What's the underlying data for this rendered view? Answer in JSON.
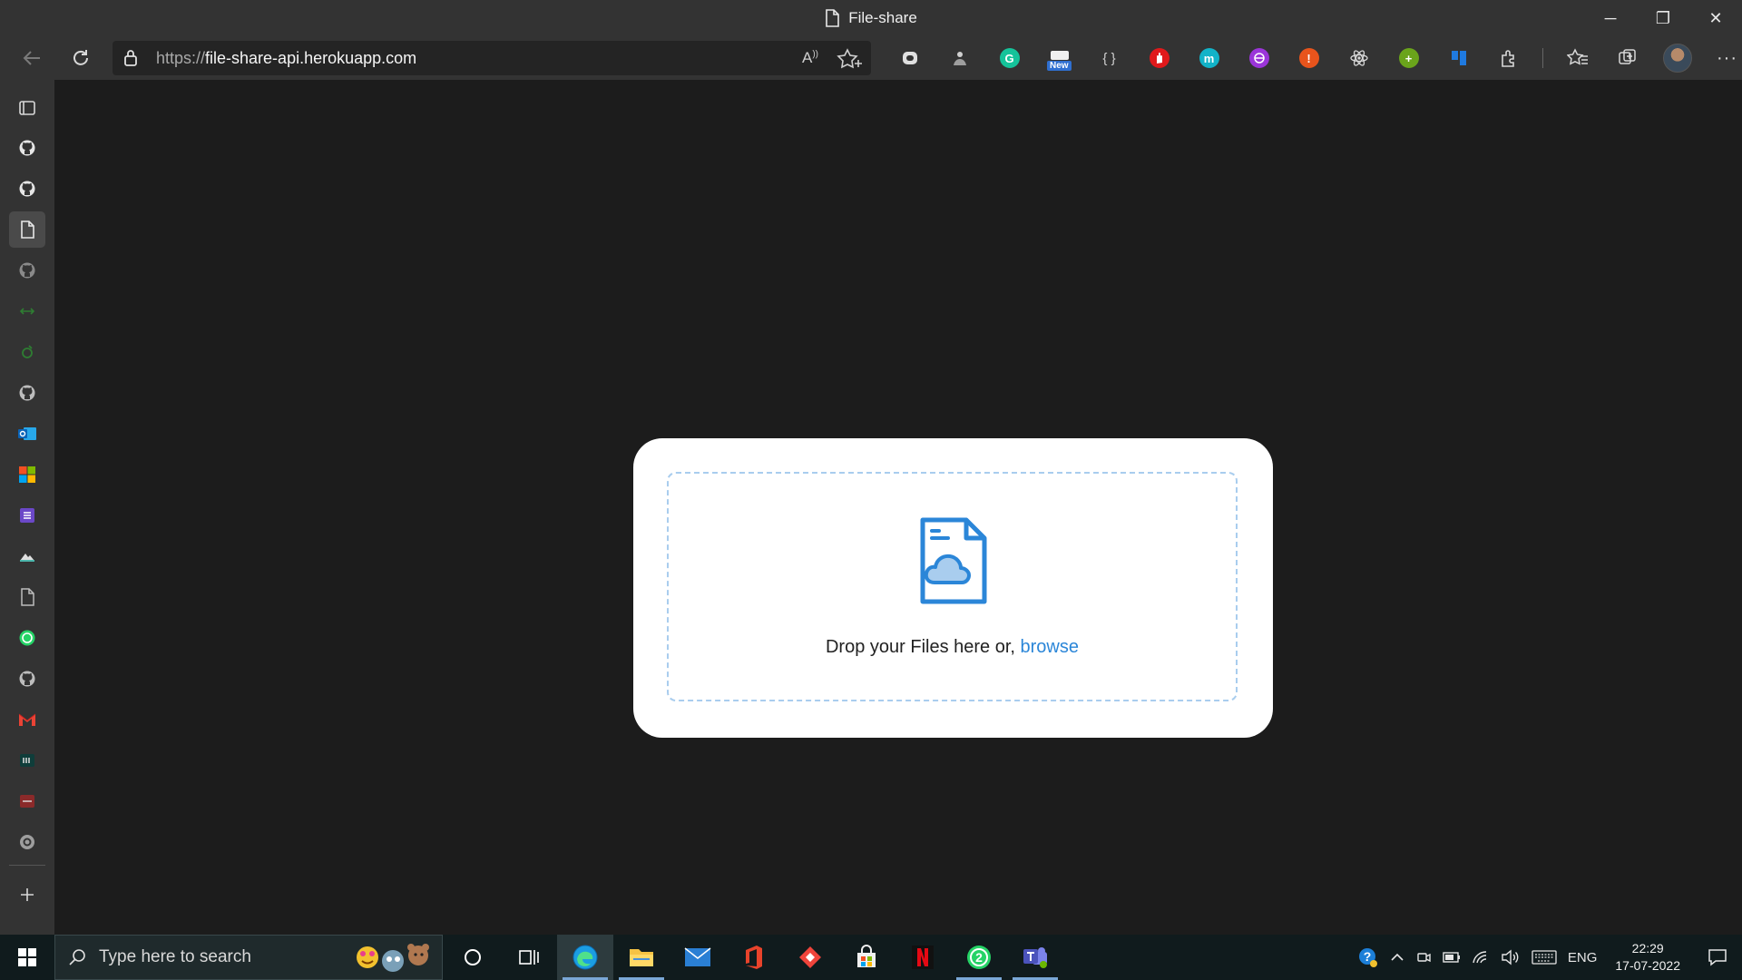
{
  "window": {
    "title": "File-share",
    "controls": {
      "minimize": "─",
      "restore": "❐",
      "close": "✕"
    }
  },
  "address_bar": {
    "scheme": "https://",
    "host": "file-share-api.herokuapp.com"
  },
  "extensions": [
    {
      "name": "ext-1",
      "label": "",
      "color": "#d9d9d9"
    },
    {
      "name": "ext-2",
      "label": "",
      "color": "#bbbbbb"
    },
    {
      "name": "grammarly",
      "label": "G",
      "color": "#15c39a"
    },
    {
      "name": "new-ext",
      "label": "New",
      "color": "#2f6fd0"
    },
    {
      "name": "json-ext",
      "label": "{ }",
      "color": "#d0d0d0"
    },
    {
      "name": "hand-ext",
      "label": "",
      "color": "#e0191b"
    },
    {
      "name": "m-ext",
      "label": "m",
      "color": "#12b3c8"
    },
    {
      "name": "purple-ext",
      "label": "",
      "color": "#9b35d9"
    },
    {
      "name": "alert-ext",
      "label": "!",
      "color": "#e8541c"
    },
    {
      "name": "react-ext",
      "label": "",
      "color": "#d0d0d0"
    },
    {
      "name": "plus-ext",
      "label": "+",
      "color": "#6aa41b"
    },
    {
      "name": "trello-ext",
      "label": "",
      "color": "#1f7ae0"
    },
    {
      "name": "puzzle-ext",
      "label": "",
      "color": "#d0d0d0"
    }
  ],
  "upload": {
    "drop_text": "Drop your Files here or, ",
    "browse_label": "browse"
  },
  "taskbar": {
    "search_placeholder": "Type here to search",
    "language": "ENG",
    "time": "22:29",
    "date": "17-07-2022"
  }
}
